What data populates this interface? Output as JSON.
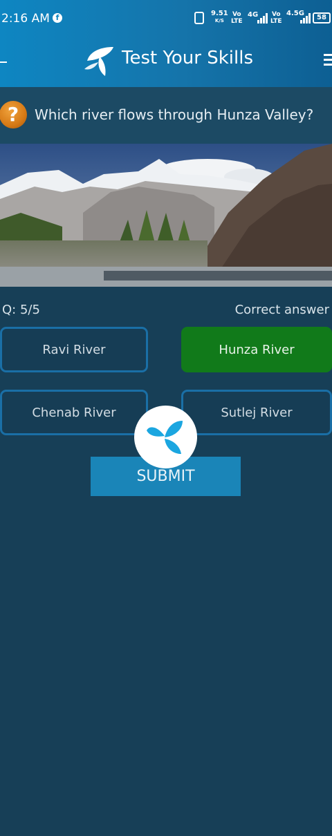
{
  "status_bar": {
    "time": "2:16 AM",
    "speed": "9.51",
    "speed_unit": "K/S",
    "net1_vo": "Vo",
    "net1_lte": "LTE",
    "net1_type": "4G",
    "net2_vo": "Vo",
    "net2_lte": "LTE",
    "net2_type": "4.5G",
    "battery": "58"
  },
  "header": {
    "title": "Test Your Skills"
  },
  "question": {
    "text": "Which river flows through Hunza Valley?",
    "icon": "?"
  },
  "quiz": {
    "progress": "Q: 5/5",
    "feedback": "Correct answer"
  },
  "options": [
    {
      "label": "Ravi River",
      "state": "default"
    },
    {
      "label": "Hunza River",
      "state": "correct"
    },
    {
      "label": "Chenab River",
      "state": "default"
    },
    {
      "label": "Sutlej River",
      "state": "default"
    }
  ],
  "submit_label": "SUBMIT",
  "colors": {
    "background": "#173f57",
    "header_gradient_start": "#0e86c2",
    "correct": "#117a1a",
    "option_border": "#1a6fa6",
    "submit": "#1a85b8",
    "brand_icon": "#1ba6e0"
  }
}
